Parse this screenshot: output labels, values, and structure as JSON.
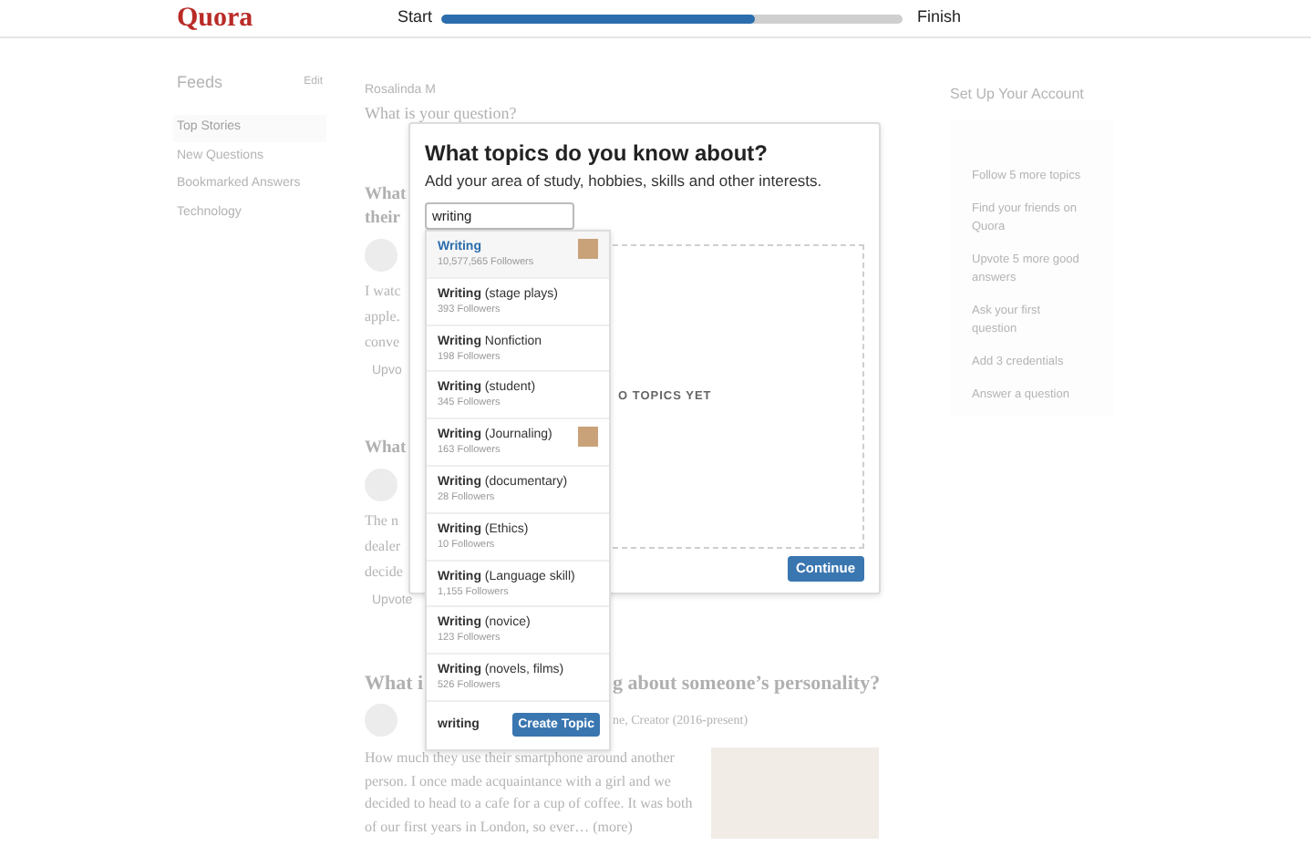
{
  "header": {
    "logo": "Quora",
    "progress": {
      "start_label": "Start",
      "end_label": "Finish",
      "level": 0.68
    }
  },
  "sidebar": {
    "title": "Feeds",
    "edit": "Edit",
    "items": [
      {
        "label": "Top Stories",
        "selected": true
      },
      {
        "label": "New Questions",
        "selected": false
      },
      {
        "label": "Bookmarked Answers",
        "selected": false
      },
      {
        "label": "Technology",
        "selected": false
      }
    ]
  },
  "feed": {
    "asker": "Rosalinda M",
    "question_prompt": "What is your question?",
    "stories": [
      {
        "title_lines": [
          "What",
          "their"
        ],
        "body_lines": [
          "I watc",
          "apple.",
          "conve"
        ],
        "upvote": "Upvo"
      },
      {
        "title_lines": [
          "What"
        ],
        "body_lines": [
          "The n",
          "dealer",
          "decide"
        ],
        "upvote": "Upvote"
      }
    ],
    "last_story": {
      "title_start": "What i",
      "title_end": "g about someone’s personality?",
      "author_end": "ne, Creator (2016-present)",
      "body": "How much they use their smartphone around another person. I once made acquaintance with a girl and we decided to head to a cafe for a cup of coffee. It was both of our first years in London, so ever…",
      "more": "(more)"
    }
  },
  "setup": {
    "title": "Set Up Your Account",
    "items": [
      "Follow 5 more topics",
      "Find your friends on Quora",
      "Upvote 5 more good answers",
      "Ask your first question",
      "Add 3 credentials",
      "Answer a question"
    ]
  },
  "modal": {
    "title": "What topics do you know about?",
    "subtitle": "Add your area of study, hobbies, skills and other interests.",
    "search": {
      "value": "writing"
    },
    "empty_text": "O TOPICS YET",
    "continue": "Continue",
    "suggestions": [
      {
        "name": "Writing",
        "followers": "10,577,565 Followers",
        "selected": true,
        "has_image": true
      },
      {
        "name": "**Writing** (stage plays)",
        "followers": "393 Followers",
        "selected": false,
        "has_image": false
      },
      {
        "name": "**Writing** Nonfiction",
        "followers": "198 Followers",
        "selected": false,
        "has_image": false
      },
      {
        "name": "**Writing** (student)",
        "followers": "345 Followers",
        "selected": false,
        "has_image": false
      },
      {
        "name": "**Writing** (Journaling)",
        "followers": "163 Followers",
        "selected": false,
        "has_image": true
      },
      {
        "name": "**Writing** (documentary)",
        "followers": "28 Followers",
        "selected": false,
        "has_image": false
      },
      {
        "name": "**Writing** (Ethics)",
        "followers": "10 Followers",
        "selected": false,
        "has_image": false
      },
      {
        "name": "**Writing** (Language skill)",
        "followers": "1,155 Followers",
        "selected": false,
        "has_image": false
      },
      {
        "name": "**Writing** (novice)",
        "followers": "123 Followers",
        "selected": false,
        "has_image": false
      },
      {
        "name": "**Writing** (novels, films)",
        "followers": "526 Followers",
        "selected": false,
        "has_image": false
      }
    ],
    "create": {
      "query": "writing",
      "button": "Create Topic"
    }
  }
}
